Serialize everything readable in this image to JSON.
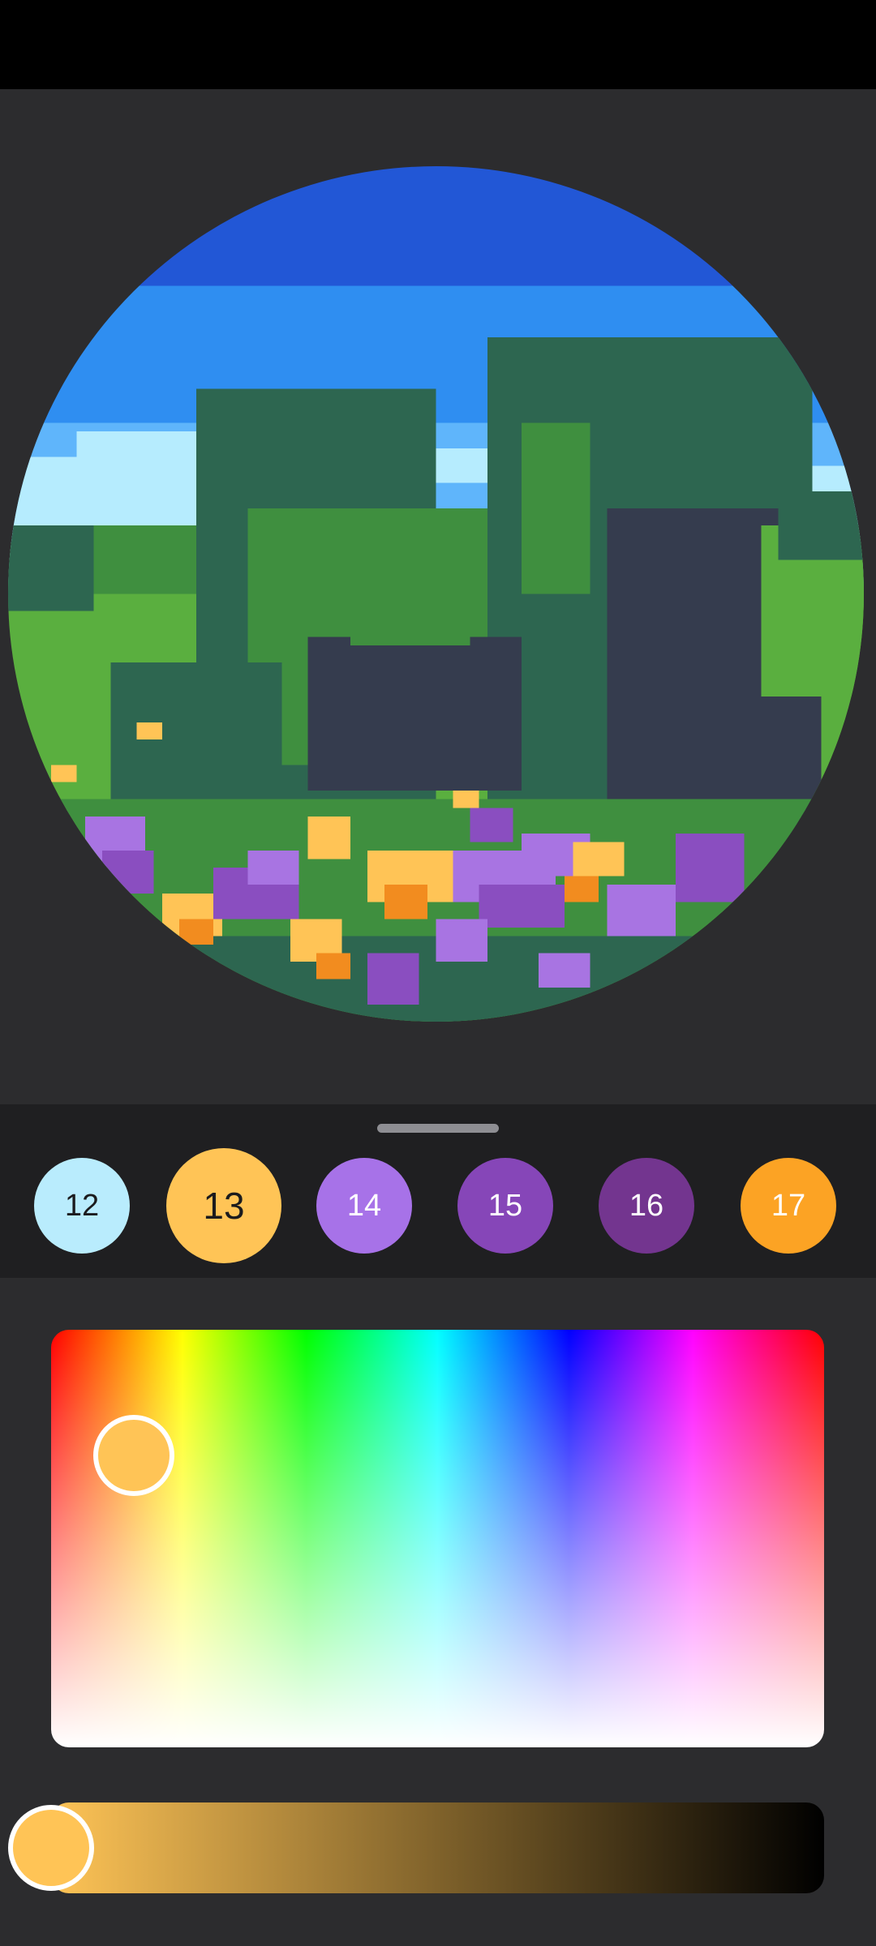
{
  "artwork": {
    "description_icon": "pixel-landscape-artwork",
    "colors": {
      "sky_deep": "#2257d6",
      "sky_blue": "#2f8ef1",
      "sky_light": "#5fb5fb",
      "cloud": "#b6ecfe",
      "grass": "#5aaf3f",
      "leaf": "#3f8f3f",
      "tree": "#2d6650",
      "shadow": "#353c4e",
      "flower_yellow": "#ffc456",
      "flower_orange": "#f28c1f",
      "flower_purple": "#8a4ec0",
      "flower_lilac": "#a874e2"
    }
  },
  "palette": {
    "selected": "13",
    "swatches": [
      {
        "label": "12",
        "color": "#b9ecfd",
        "text_color": "#1b1b1d"
      },
      {
        "label": "13",
        "color": "#ffc456",
        "text_color": "#1b1b1d"
      },
      {
        "label": "14",
        "color": "#a772e8",
        "text_color": "#ffffff"
      },
      {
        "label": "15",
        "color": "#8646b8",
        "text_color": "#ffffff"
      },
      {
        "label": "16",
        "color": "#73358f",
        "text_color": "#ffffff"
      },
      {
        "label": "17",
        "color": "#fca324",
        "text_color": "#ffffff"
      }
    ]
  },
  "color_picker": {
    "current_color": "#ffc456",
    "brightness_value": 1.0,
    "hue_field_icon": "hue-saturation-field",
    "brightness_icon": "brightness-slider"
  }
}
